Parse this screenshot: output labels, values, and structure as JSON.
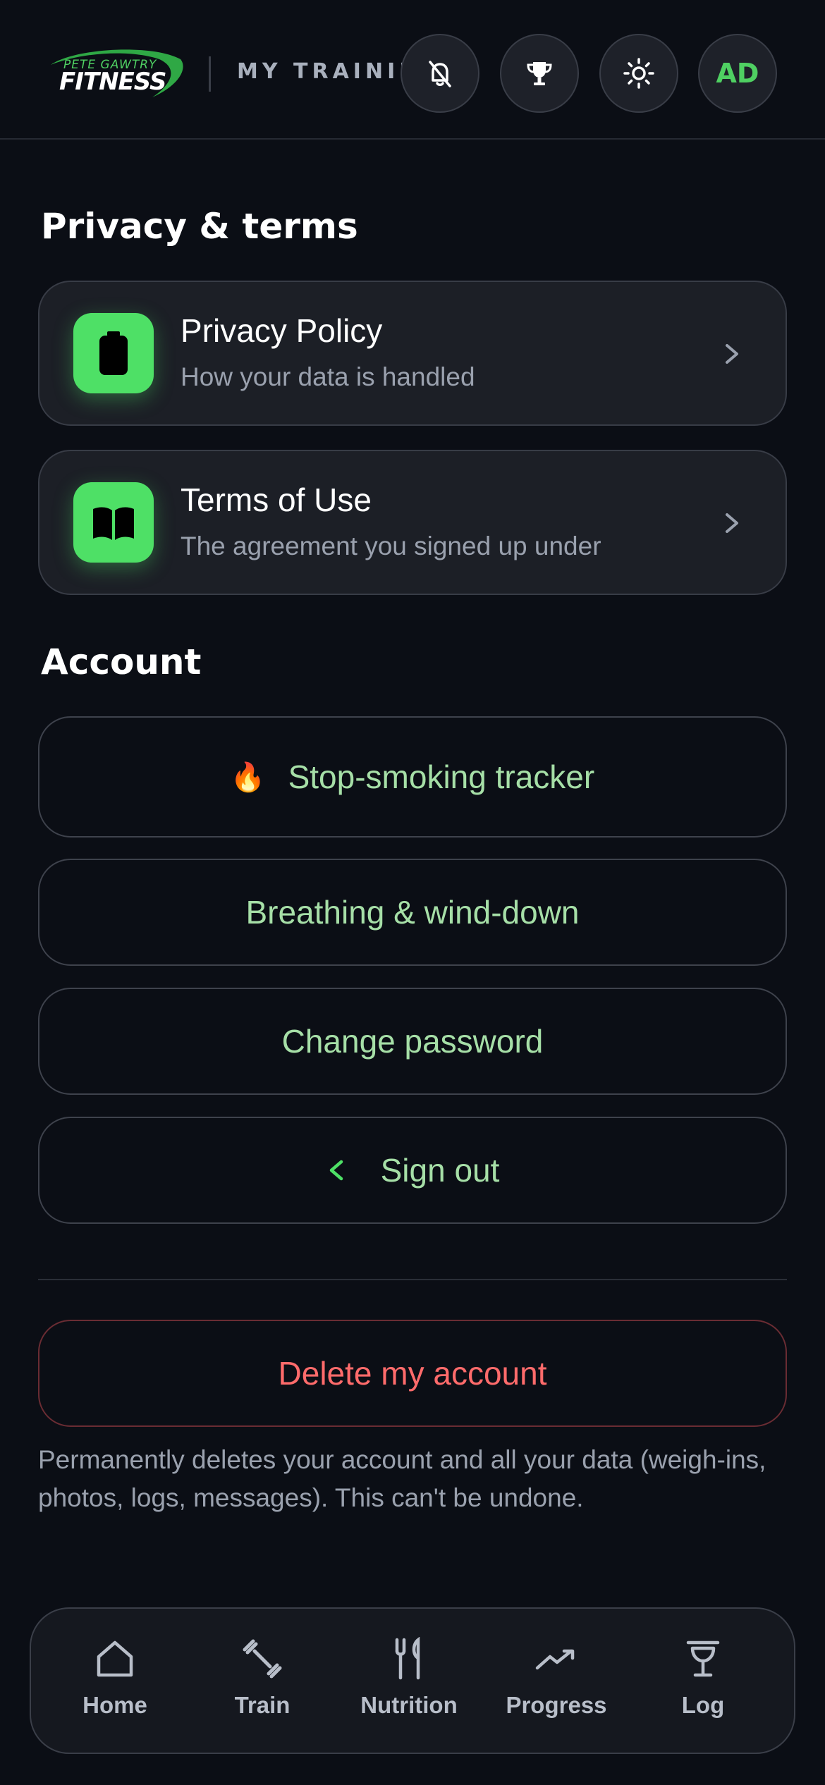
{
  "header": {
    "logo_top": "PETE GAWTRY",
    "logo_main": "FITNESS",
    "label": "MY TRAINING",
    "avatar_initials": "AD",
    "icons": [
      "bell-off-icon",
      "trophy-icon",
      "sun-icon"
    ]
  },
  "privacy": {
    "title": "Privacy & terms",
    "items": [
      {
        "title": "Privacy Policy",
        "subtitle": "How your data is handled",
        "icon": "battery-icon"
      },
      {
        "title": "Terms of Use",
        "subtitle": "The agreement you signed up under",
        "icon": "book-icon"
      }
    ]
  },
  "account": {
    "title": "Account",
    "stop_smoking": {
      "emoji": "🔥",
      "label": "Stop-smoking tracker"
    },
    "breathing": {
      "label": "Breathing & wind-down"
    },
    "change_password": {
      "label": "Change password"
    },
    "sign_out": {
      "label": "Sign out"
    },
    "delete": {
      "label": "Delete my account",
      "note": "Permanently deletes your account and all your data (weigh-ins, photos, logs, messages). This can't be undone."
    }
  },
  "nav": {
    "items": [
      {
        "label": "Home",
        "icon": "home-icon"
      },
      {
        "label": "Train",
        "icon": "dumbbell-icon"
      },
      {
        "label": "Nutrition",
        "icon": "fork-knife-icon"
      },
      {
        "label": "Progress",
        "icon": "trend-up-icon"
      },
      {
        "label": "Log",
        "icon": "scale-icon"
      }
    ]
  },
  "colors": {
    "background": "#0b0e15",
    "accent_green": "#4ee066",
    "soft_green_text": "#a6dfa7",
    "danger_red": "#ff6b6b",
    "card_bg": "#1c1f26"
  }
}
